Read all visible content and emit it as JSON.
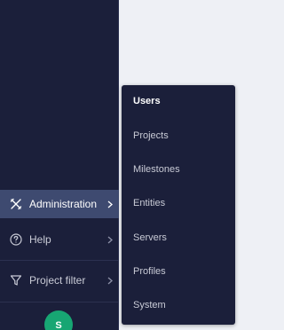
{
  "sidebar": {
    "items": [
      {
        "label": "Administration",
        "icon": "tools-icon",
        "active": true
      },
      {
        "label": "Help",
        "icon": "help-circle-icon",
        "active": false
      },
      {
        "label": "Project filter",
        "icon": "filter-icon",
        "active": false
      }
    ],
    "avatar_initial": "S",
    "avatar_color": "#17a673"
  },
  "admin_menu": {
    "items": [
      {
        "label": "Users",
        "active": true
      },
      {
        "label": "Projects"
      },
      {
        "label": "Milestones"
      },
      {
        "label": "Entities"
      },
      {
        "label": "Servers"
      },
      {
        "label": "Profiles"
      },
      {
        "label": "System"
      }
    ]
  },
  "colors": {
    "sidebar_bg": "#1b1f3a",
    "active_item_bg": "#3e4a70",
    "page_bg": "#eef0f5",
    "avatar_green": "#17a673"
  }
}
